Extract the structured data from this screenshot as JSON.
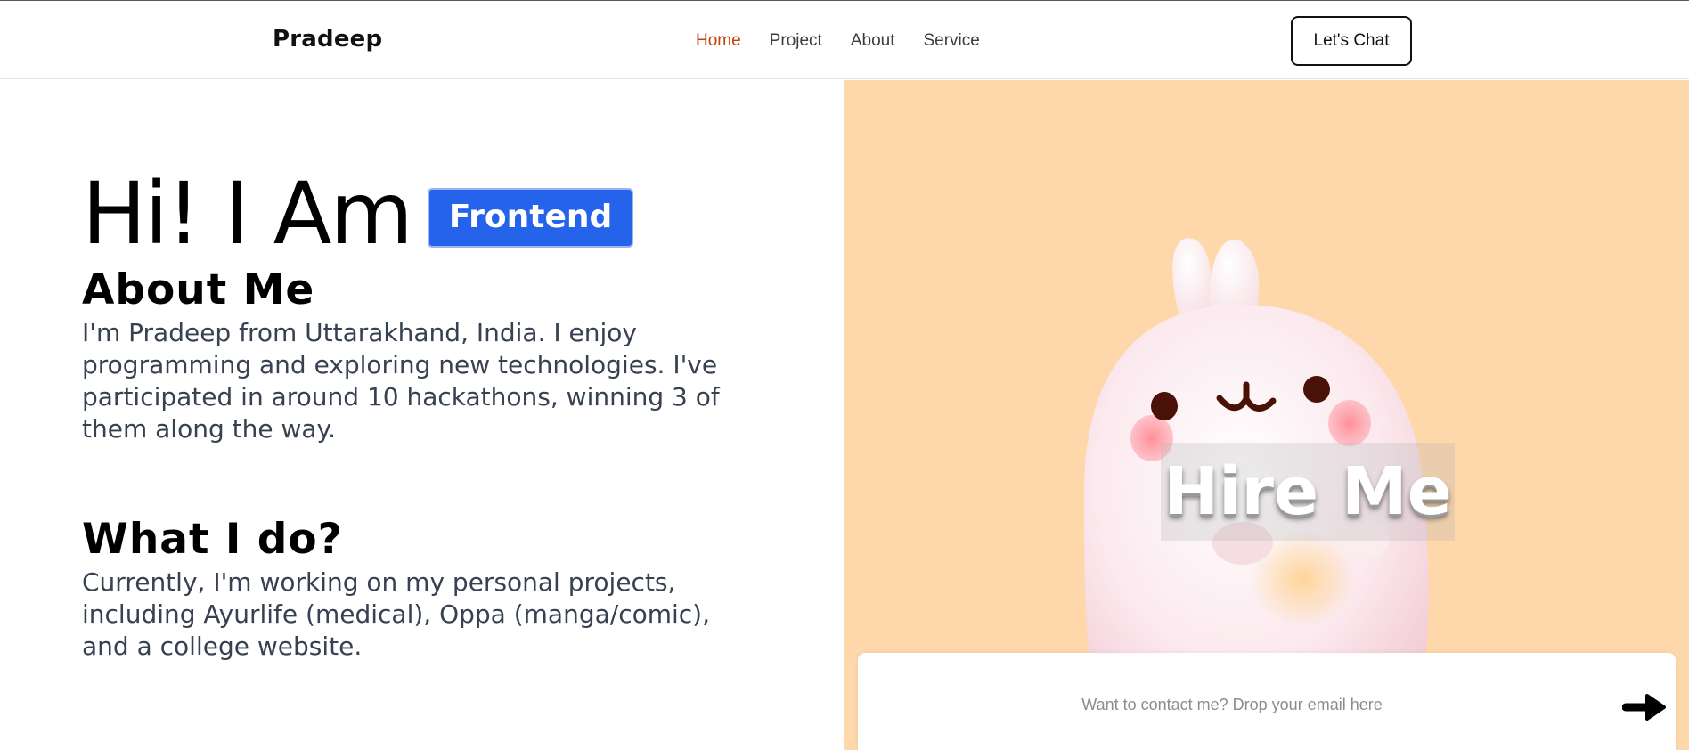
{
  "nav": {
    "brand": "Pradeep",
    "links": [
      {
        "label": "Home",
        "active": true
      },
      {
        "label": "Project",
        "active": false
      },
      {
        "label": "About",
        "active": false
      },
      {
        "label": "Service",
        "active": false
      }
    ],
    "cta_label": "Let's Chat"
  },
  "hero": {
    "greeting": "Hi! I Am",
    "role": "Frontend"
  },
  "about": {
    "title": "About Me",
    "text": "I'm Pradeep from Uttarakhand, India. I enjoy programming and exploring new technologies. I've participated in around 10 hackathons, winning 3 of them along the way."
  },
  "what": {
    "title": "What I do?",
    "text": "Currently, I'm working on my personal projects, including Ayurlife (medical), Oppa (manga/comic), and a college website."
  },
  "promo": {
    "hire_text": "Hire Me",
    "email_placeholder": "Want to contact me? Drop your email here",
    "send_icon": "arrow-right-icon"
  },
  "colors": {
    "accent_active": "#c2410c",
    "badge_blue": "#2563eb",
    "promo_bg": "#fed7aa",
    "body_text": "#374151"
  }
}
